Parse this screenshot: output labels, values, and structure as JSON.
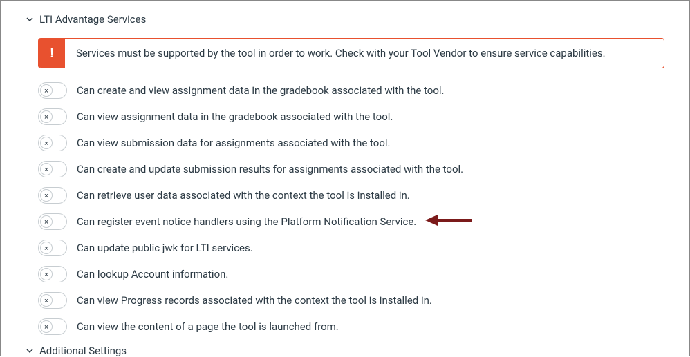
{
  "sections": {
    "lti": {
      "title": "LTI Advantage Services",
      "alert": "Services must be supported by the tool in order to work. Check with your Tool Vendor to ensure service capabilities."
    },
    "additional": {
      "title": "Additional Settings"
    }
  },
  "services": [
    {
      "label": "Can create and view assignment data in the gradebook associated with the tool.",
      "highlighted": false
    },
    {
      "label": "Can view assignment data in the gradebook associated with the tool.",
      "highlighted": false
    },
    {
      "label": "Can view submission data for assignments associated with the tool.",
      "highlighted": false
    },
    {
      "label": "Can create and update submission results for assignments associated with the tool.",
      "highlighted": false
    },
    {
      "label": "Can retrieve user data associated with the context the tool is installed in.",
      "highlighted": false
    },
    {
      "label": "Can register event notice handlers using the Platform Notification Service.",
      "highlighted": true
    },
    {
      "label": "Can update public jwk for LTI services.",
      "highlighted": false
    },
    {
      "label": "Can lookup Account information.",
      "highlighted": false
    },
    {
      "label": "Can view Progress records associated with the context the tool is installed in.",
      "highlighted": false
    },
    {
      "label": "Can view the content of a page the tool is launched from.",
      "highlighted": false
    }
  ],
  "toggle_off_glyph": "×",
  "alert_glyph": "!",
  "arrow_color": "#7b1a1a"
}
